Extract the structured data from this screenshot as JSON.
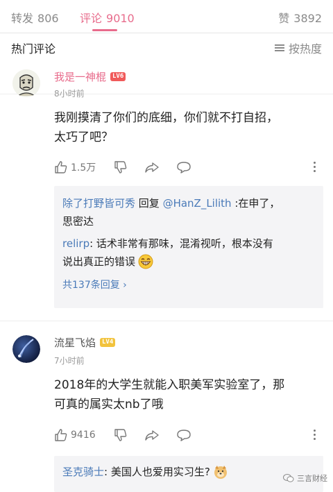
{
  "tabs": {
    "repost": {
      "label": "转发",
      "count": "806"
    },
    "comment": {
      "label": "评论",
      "count": "9010"
    },
    "like": {
      "label": "赞",
      "count": "3892"
    }
  },
  "section": {
    "title": "热门评论",
    "sort_label": "按热度"
  },
  "comments": [
    {
      "username": "我是一神棍",
      "level": "LV6",
      "time": "8小时前",
      "content_line1": "我刚摸清了你们的底细，你们就不打自招，",
      "content_line2": "太巧了吧？",
      "likes": "1.5万",
      "replies": [
        {
          "name": "除了打野皆可秀",
          "mid": " 回复 ",
          "mention": "@HanZ_Lilith",
          "text1": " :在申了，",
          "text2": "思密达"
        },
        {
          "name": "relirp",
          "text1": ": 话术非常有那味，混淆视听，根本没有",
          "text2": "说出真正的错误"
        }
      ],
      "reply_count_text": "共137条回复 ›"
    },
    {
      "username": "流星飞焰",
      "level": "LV4",
      "time": "7小时前",
      "content_line1": "2018年的大学生就能入职美军实验室了，那",
      "content_line2": "可真的属实太nb了哦",
      "likes": "9416",
      "replies": [
        {
          "name": "圣克骑士",
          "text1": ": 美国人也爱用实习生?"
        }
      ]
    }
  ],
  "watermark": "三言财经",
  "colors": {
    "accent": "#e86c8c",
    "link": "#4a7ab8",
    "lv6": "#f05a5a",
    "lv4": "#f2c33d"
  }
}
